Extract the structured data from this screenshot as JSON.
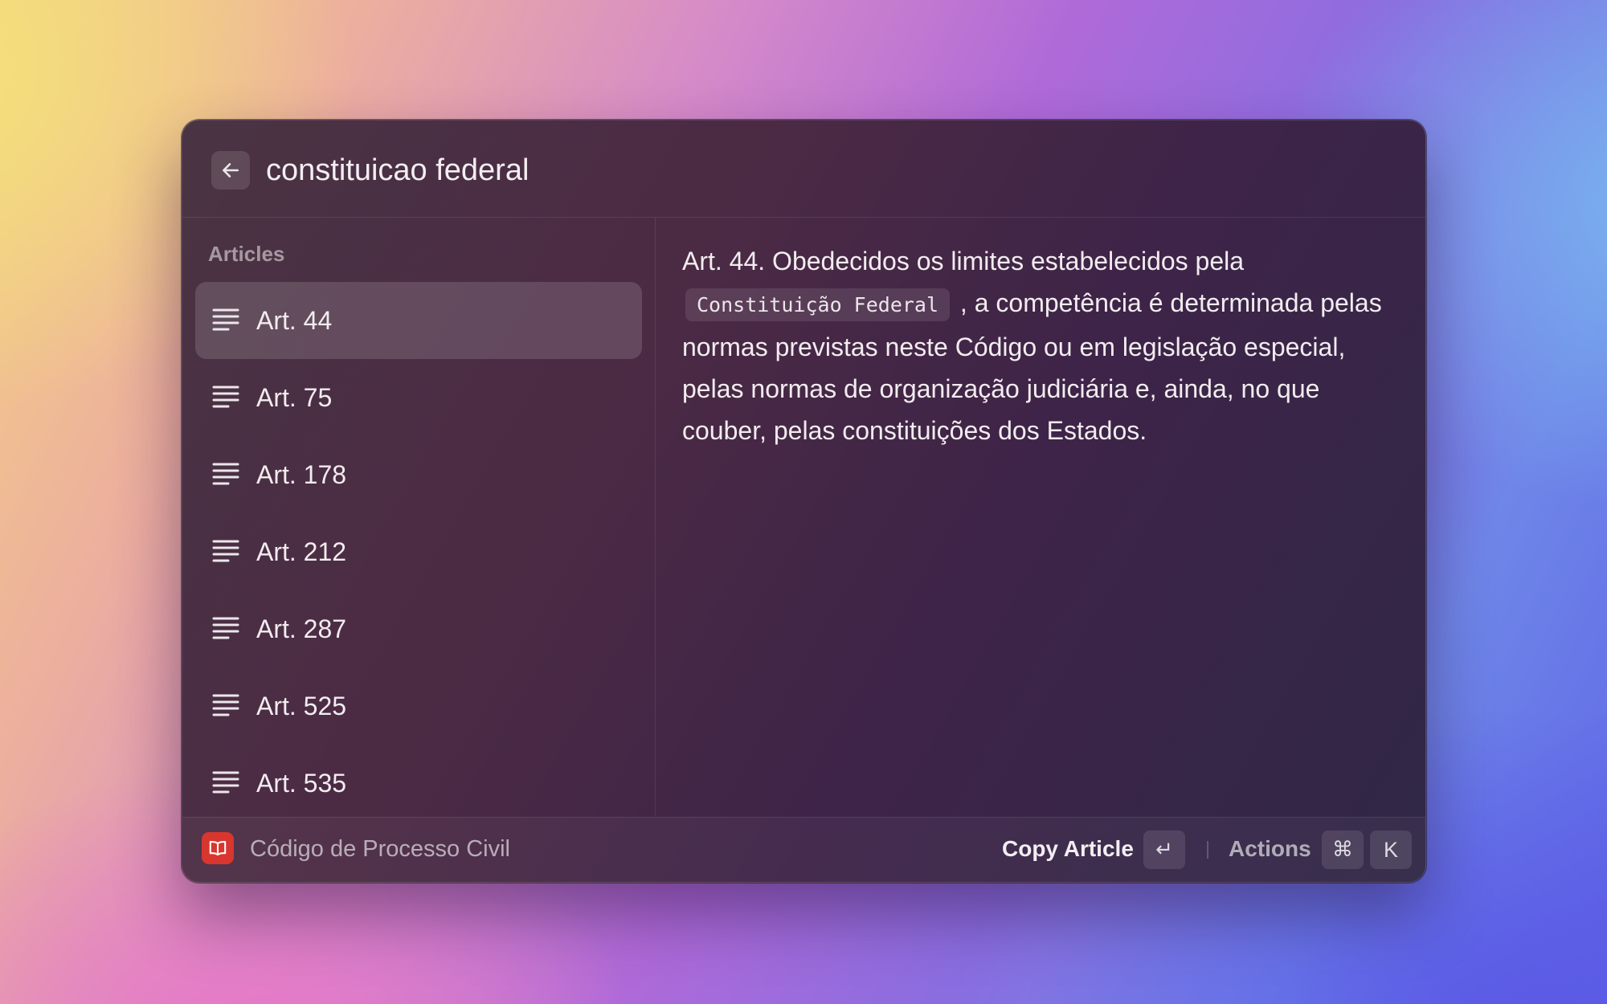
{
  "search": {
    "value": "constituicao federal",
    "back_icon": "arrow-left-icon"
  },
  "list": {
    "section_title": "Articles",
    "item_icon": "text-align-left-icon",
    "items": [
      {
        "label": "Art. 44",
        "selected": true
      },
      {
        "label": "Art. 75",
        "selected": false
      },
      {
        "label": "Art. 178",
        "selected": false
      },
      {
        "label": "Art. 212",
        "selected": false
      },
      {
        "label": "Art. 287",
        "selected": false
      },
      {
        "label": "Art. 525",
        "selected": false
      },
      {
        "label": "Art. 535",
        "selected": false
      }
    ]
  },
  "detail": {
    "text_before": "Art. 44. Obedecidos os limites estabelecidos pela",
    "highlight": "Constituição Federal",
    "text_after": ", a competência é determinada pelas normas previstas neste Código ou em legislação especial, pelas normas de organização judiciária e, ainda, no que couber, pelas constituições dos Estados."
  },
  "footer": {
    "app_icon": "book-icon",
    "app_icon_color": "#d8362f",
    "app_name": "Código de Processo Civil",
    "primary_action": "Copy Article",
    "primary_shortcut": "↵",
    "actions_label": "Actions",
    "actions_shortcut": [
      "⌘",
      "K"
    ]
  }
}
